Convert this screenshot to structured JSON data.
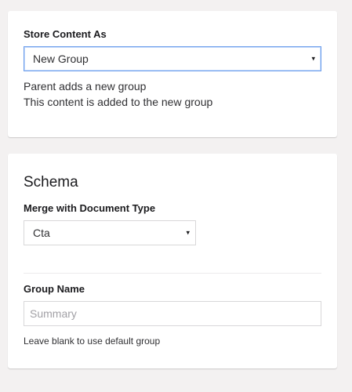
{
  "store_card": {
    "label": "Store Content As",
    "select_value": "New Group",
    "caret": "▾",
    "description_line1": "Parent adds a new group",
    "description_line2": "This content is added to the new group"
  },
  "schema_card": {
    "heading": "Schema",
    "merge_label": "Merge with Document Type",
    "merge_select_value": "Cta",
    "caret": "▾",
    "group_name_label": "Group Name",
    "group_name_value": "",
    "group_name_placeholder": "Summary",
    "hint": "Leave blank to use default group"
  },
  "colors": {
    "page_background": "#f3f1f1",
    "card_background": "#ffffff",
    "focus_border": "#6d9eeb"
  }
}
